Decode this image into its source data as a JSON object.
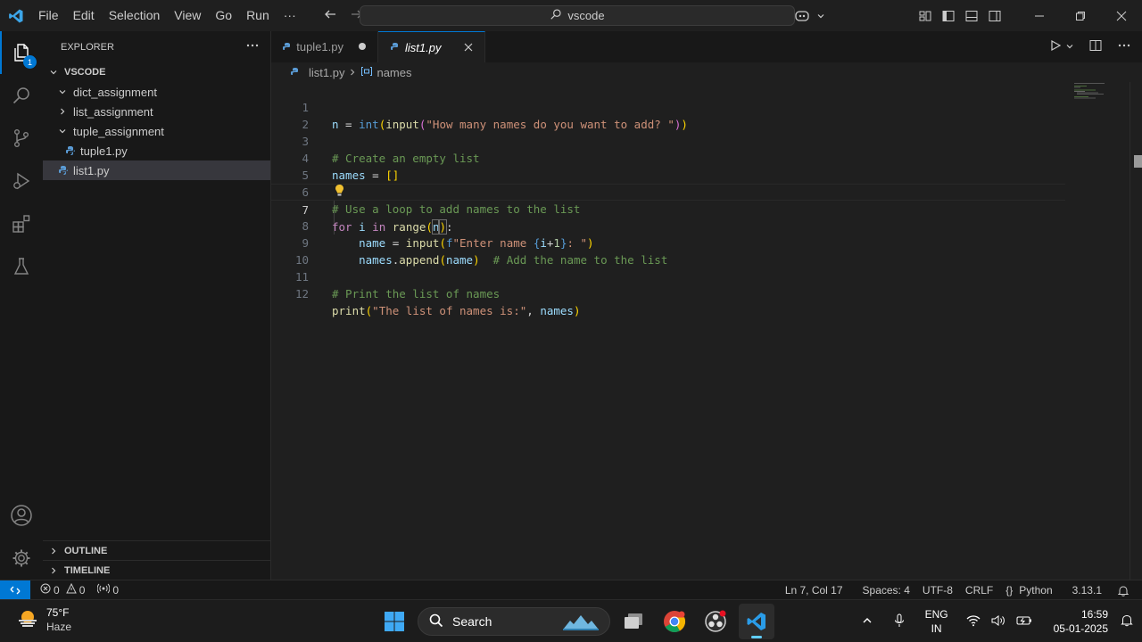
{
  "titlebar": {
    "menu": [
      "File",
      "Edit",
      "Selection",
      "View",
      "Go",
      "Run",
      "···"
    ],
    "search_text": "vscode"
  },
  "activity": {
    "explorer_badge": "1"
  },
  "sidebar": {
    "header": "EXPLORER",
    "root": "VSCODE",
    "items": [
      {
        "label": "dict_assignment"
      },
      {
        "label": "list_assignment"
      },
      {
        "label": "tuple_assignment"
      },
      {
        "label": "tuple1.py"
      },
      {
        "label": "list1.py"
      }
    ],
    "outline": "OUTLINE",
    "timeline": "TIMELINE"
  },
  "tabs": [
    {
      "label": "tuple1.py",
      "state": "modified"
    },
    {
      "label": "list1.py",
      "state": "active"
    }
  ],
  "breadcrumb": {
    "file": "list1.py",
    "symbol": "names"
  },
  "editor": {
    "current_line": 7,
    "lines": [
      {
        "n": "1",
        "text": "n = int(input(\"How many names do you want to add? \"))"
      },
      {
        "n": "2",
        "text": ""
      },
      {
        "n": "3",
        "text": "# Create an empty list"
      },
      {
        "n": "4",
        "text": "names = []"
      },
      {
        "n": "5",
        "text": ""
      },
      {
        "n": "6",
        "text": "# Use a loop to add names to the list"
      },
      {
        "n": "7",
        "text": "for i in range(n):"
      },
      {
        "n": "8",
        "text": "    name = input(f\"Enter name {i+1}: \")"
      },
      {
        "n": "9",
        "text": "    names.append(name)  # Add the name to the list"
      },
      {
        "n": "10",
        "text": ""
      },
      {
        "n": "11",
        "text": "# Print the list of names"
      },
      {
        "n": "12",
        "text": "print(\"The list of names is:\", names)"
      }
    ]
  },
  "statusbar": {
    "errors": "0",
    "warnings": "0",
    "ports": "0",
    "position": "Ln 7, Col 17",
    "spaces": "Spaces: 4",
    "encoding": "UTF-8",
    "eol": "CRLF",
    "language_braces": "{}",
    "language": "Python",
    "version": "3.13.1"
  },
  "taskbar": {
    "temperature": "75°F",
    "weather": "Haze",
    "search": "Search",
    "lang_1": "ENG",
    "lang_2": "IN",
    "time": "16:59",
    "date": "05-01-2025"
  },
  "colors": {
    "accent": "#0078d4",
    "background": "#1f1f1f",
    "sidebar": "#181818"
  }
}
